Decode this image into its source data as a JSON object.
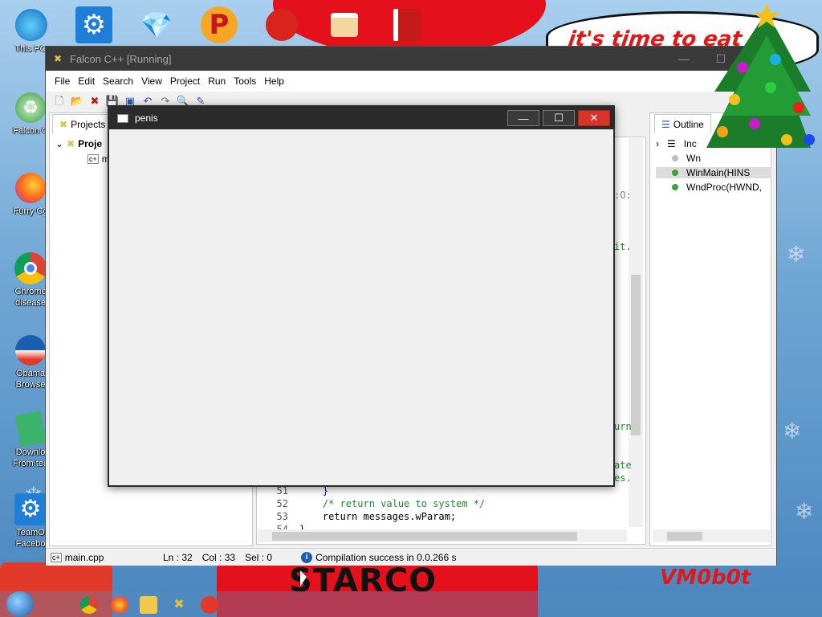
{
  "desktop": {
    "speech_text": "it's time to eat",
    "bottom_text": "STARCO",
    "signature_text": "VM0b0t",
    "icons": [
      {
        "label": "This PC"
      },
      {
        "label": "Falcon C"
      },
      {
        "label": "Furry Co"
      },
      {
        "label": "Chrome\ndisease"
      },
      {
        "label": "Obama\nBrowse"
      },
      {
        "label": "Downlo\nFrom tea"
      },
      {
        "label": "TeamO\nFacebo"
      }
    ]
  },
  "falcon": {
    "title": "Falcon C++ [Running]",
    "menu": [
      "File",
      "Edit",
      "Search",
      "View",
      "Project",
      "Run",
      "Tools",
      "Help"
    ],
    "projects_tab": "Projects",
    "project_node": "Proje",
    "file_node": "m",
    "outline_tab": "Outline",
    "outline_items": [
      "Inc",
      "Wn",
      "WinMain(HINS",
      "WndProc(HWND,"
    ],
    "editor_fragments": [
      ":O:",
      "it.",
      "urn",
      "ate",
      "es."
    ],
    "code_lines": [
      {
        "ln": "51",
        "code": "    }"
      },
      {
        "ln": "52",
        "code": "    /* return value to system */"
      },
      {
        "ln": "53",
        "code": "    return messages.wParam;"
      },
      {
        "ln": "54",
        "code": "}"
      }
    ],
    "status": {
      "file": "main.cpp",
      "ln": "Ln : 32",
      "col": "Col : 33",
      "sel": "Sel : 0",
      "message": "Compilation success in 0.0.266 s"
    }
  },
  "popup": {
    "title": "penis",
    "minimize": "—",
    "maximize": "☐",
    "close": "✕"
  }
}
